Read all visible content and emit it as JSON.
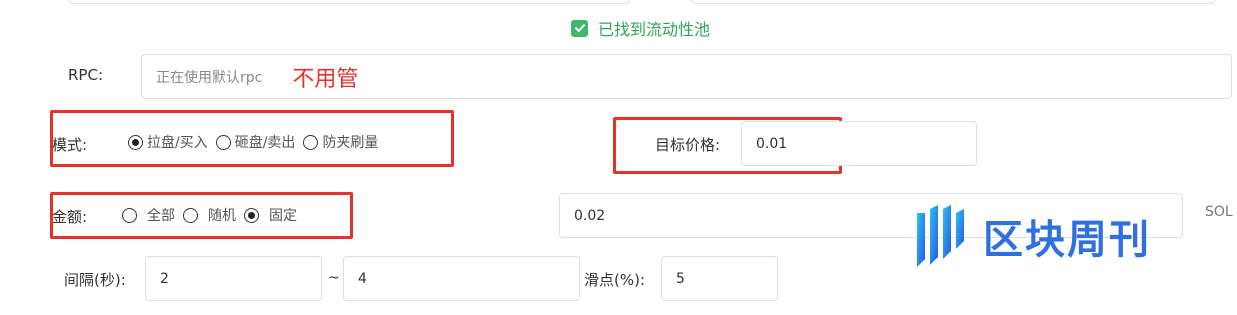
{
  "status": {
    "text": "已找到流动性池",
    "color": "#2fa35c"
  },
  "rpc": {
    "label": "RPC:",
    "placeholder": "正在使用默认rpc",
    "annotation": "不用管"
  },
  "mode": {
    "label": "模式:",
    "options": [
      "拉盘/买入",
      "砸盘/卖出",
      "防夹刷量"
    ],
    "selected": "拉盘/买入"
  },
  "target_price": {
    "label": "目标价格:",
    "value": "0.01"
  },
  "amount": {
    "label": "金额:",
    "options": [
      "全部",
      "随机",
      "固定"
    ],
    "selected": "固定",
    "value": "0.02",
    "unit": "SOL"
  },
  "interval": {
    "label": "间隔(秒):",
    "min": "2",
    "separator": "~",
    "max": "4"
  },
  "slippage": {
    "label": "滑点(%):",
    "value": "5"
  },
  "watermark": {
    "text": "区块周刊"
  },
  "colors": {
    "annotation_red": "#e5322d",
    "accent_green": "#3fb86e",
    "watermark_blue": "#2f6fe0"
  }
}
